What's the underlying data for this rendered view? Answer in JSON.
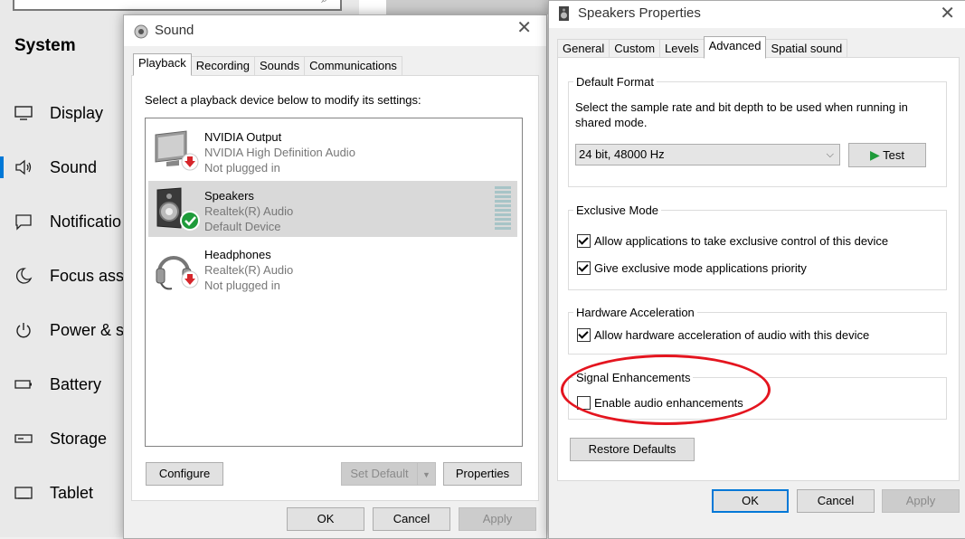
{
  "settings": {
    "section_title": "System",
    "nav": [
      {
        "label": "Display",
        "icon": "monitor-icon"
      },
      {
        "label": "Sound",
        "icon": "speaker-icon"
      },
      {
        "label": "Notificatio",
        "icon": "notification-icon"
      },
      {
        "label": "Focus assis",
        "icon": "moon-icon"
      },
      {
        "label": "Power & sl",
        "icon": "power-icon"
      },
      {
        "label": "Battery",
        "icon": "battery-icon"
      },
      {
        "label": "Storage",
        "icon": "storage-icon"
      },
      {
        "label": "Tablet",
        "icon": "tablet-icon"
      }
    ]
  },
  "sound_dialog": {
    "title": "Sound",
    "tabs": [
      "Playback",
      "Recording",
      "Sounds",
      "Communications"
    ],
    "instruction": "Select a playback device below to modify its settings:",
    "devices": [
      {
        "name": "NVIDIA Output",
        "driver": "NVIDIA High Definition Audio",
        "status": "Not plugged in",
        "icon": "monitor-unplugged-icon"
      },
      {
        "name": "Speakers",
        "driver": "Realtek(R) Audio",
        "status": "Default Device",
        "icon": "speaker-default-icon"
      },
      {
        "name": "Headphones",
        "driver": "Realtek(R) Audio",
        "status": "Not plugged in",
        "icon": "headphones-unplugged-icon"
      }
    ],
    "buttons": {
      "configure": "Configure",
      "set_default": "Set Default",
      "properties": "Properties",
      "ok": "OK",
      "cancel": "Cancel",
      "apply": "Apply"
    }
  },
  "props_dialog": {
    "title": "Speakers Properties",
    "tabs": [
      "General",
      "Custom",
      "Levels",
      "Advanced",
      "Spatial sound"
    ],
    "active_tab": "Advanced",
    "default_format": {
      "label": "Default Format",
      "description": "Select the sample rate and bit depth to be used when running in shared mode.",
      "selected": "24 bit, 48000 Hz",
      "test_label": "Test"
    },
    "exclusive_mode": {
      "label": "Exclusive Mode",
      "options": [
        {
          "label": "Allow applications to take exclusive control of this device",
          "checked": true
        },
        {
          "label": "Give exclusive mode applications priority",
          "checked": true
        }
      ]
    },
    "hardware_acceleration": {
      "label": "Hardware Acceleration",
      "option": {
        "label": "Allow hardware acceleration of audio with this device",
        "checked": true
      }
    },
    "signal_enhancements": {
      "label": "Signal Enhancements",
      "option": {
        "label": "Enable audio enhancements",
        "checked": false
      }
    },
    "restore_defaults": "Restore Defaults",
    "buttons": {
      "ok": "OK",
      "cancel": "Cancel",
      "apply": "Apply"
    }
  },
  "colors": {
    "accent": "#0078d7",
    "annotation": "#e4151f",
    "default_check": "#1e9b3a",
    "unplugged": "#d6262b"
  }
}
